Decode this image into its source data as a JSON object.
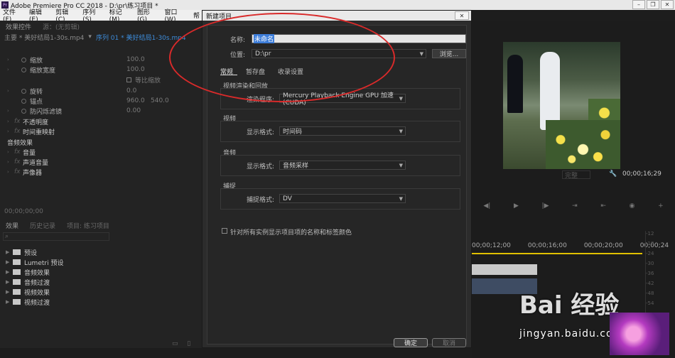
{
  "window": {
    "title": "Adobe Premiere Pro CC 2018 - D:\\pr\\练习项目 *"
  },
  "menu": [
    "文件(F)",
    "编辑(E)",
    "剪辑(C)",
    "序列(S)",
    "标记(M)",
    "图形(G)",
    "窗口(W)",
    "帮"
  ],
  "effect_controls": {
    "tabs": [
      "效果控件",
      "源：(无剪辑)"
    ],
    "source_label": "主要 * 美好结局1-30s.mp4",
    "sequence_label": "序列 01 * 美好结局1-30s.mp4",
    "rows": [
      {
        "label": "缩放",
        "value": "100.0"
      },
      {
        "label": "缩放宽度",
        "value": "100.0"
      },
      {
        "label": "等比缩放",
        "type": "check"
      },
      {
        "label": "旋转",
        "value": "0.0"
      },
      {
        "label": "锚点",
        "value": "960.0",
        "value2": "540.0"
      },
      {
        "label": "防闪烁滤镜",
        "value": "0.00"
      },
      {
        "label": "不透明度",
        "type": "fx"
      },
      {
        "label": "时间重映射",
        "type": "fx"
      },
      {
        "label": "音频效果",
        "type": "header"
      },
      {
        "label": "音量",
        "type": "fx"
      },
      {
        "label": "声道音量",
        "type": "fx"
      },
      {
        "label": "声像器",
        "type": "fx"
      }
    ],
    "timecode": "00;00;00;00"
  },
  "effects_panel": {
    "tabs": [
      "效果",
      "历史记录",
      "项目: 练习项目"
    ],
    "tree": [
      "预设",
      "Lumetri 预设",
      "音频效果",
      "音频过渡",
      "视频效果",
      "视频过渡"
    ]
  },
  "dialog": {
    "title": "新建项目",
    "close": "✕",
    "name_label": "名称:",
    "name_value": "未命名",
    "location_label": "位置:",
    "location_value": "D:\\pr",
    "browse_label": "浏览...",
    "tabs": [
      "常规",
      "暂存盘",
      "收录设置"
    ],
    "groups": [
      {
        "title": "视频渲染和回放",
        "field_label": "渲染程序:",
        "field_value": "Mercury Playback Engine GPU 加速 (CUDA)"
      },
      {
        "title": "视频",
        "field_label": "显示格式:",
        "field_value": "时间码"
      },
      {
        "title": "音频",
        "field_label": "显示格式:",
        "field_value": "音频采样"
      },
      {
        "title": "捕捉",
        "field_label": "捕捉格式:",
        "field_value": "DV"
      }
    ],
    "checkbox_label": "针对所有实例显示项目项的名称和标签颜色",
    "ok_label": "确定",
    "cancel_label": "取消"
  },
  "program_monitor": {
    "fit_label": "完整",
    "timecode": "00;00;16;29",
    "ruler": [
      "00;00;12;00",
      "00;00;16;00",
      "00;00;20;00",
      "00;00;24"
    ],
    "meter_marks": [
      "-12",
      "-18",
      "-24",
      "-30",
      "-36",
      "-42",
      "-48",
      "-54"
    ]
  },
  "watermark": {
    "logo": "Bai 经验",
    "url": "jingyan.baidu.com"
  }
}
